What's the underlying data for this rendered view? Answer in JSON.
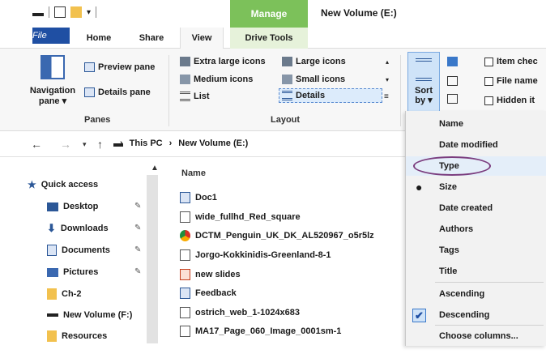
{
  "title_bar": {
    "manage_tab": "Manage",
    "window_title": "New Volume (E:)"
  },
  "ribbon_tabs": [
    "File",
    "Home",
    "Share",
    "View",
    "Drive Tools"
  ],
  "ribbon": {
    "panes": {
      "navigation_pane": "Navigation pane ▾",
      "preview_pane": "Preview pane",
      "details_pane": "Details pane",
      "group_label": "Panes"
    },
    "layout": {
      "extra_large_icons": "Extra large icons",
      "large_icons": "Large icons",
      "medium_icons": "Medium icons",
      "small_icons": "Small icons",
      "list": "List",
      "details": "Details",
      "group_label": "Layout"
    },
    "sort_by": "Sort by ▾",
    "show_hide": {
      "item_check_boxes": "Item chec",
      "file_name_extensions": "File name",
      "hidden_items": "Hidden it"
    }
  },
  "address_bar": {
    "crumbs": [
      "This PC",
      "New Volume (E:)"
    ]
  },
  "nav_pane": {
    "items": [
      {
        "label": "Quick access",
        "icon": "star-icon",
        "pinned": false
      },
      {
        "label": "Desktop",
        "icon": "desktop-folder-icon",
        "pinned": true
      },
      {
        "label": "Downloads",
        "icon": "download-arrow-icon",
        "pinned": true
      },
      {
        "label": "Documents",
        "icon": "documents-icon",
        "pinned": true
      },
      {
        "label": "Pictures",
        "icon": "pictures-icon",
        "pinned": true
      },
      {
        "label": "Ch-2",
        "icon": "folder-icon",
        "pinned": false
      },
      {
        "label": "New Volume (F:)",
        "icon": "drive-icon",
        "pinned": false
      },
      {
        "label": "Resources",
        "icon": "folder-icon",
        "pinned": false
      }
    ]
  },
  "file_list": {
    "column_header": "Name",
    "files": [
      {
        "name": "Doc1",
        "icon": "word-doc-icon"
      },
      {
        "name": "wide_fullhd_Red_square",
        "icon": "image-file-icon"
      },
      {
        "name": "DCTM_Penguin_UK_DK_AL520967_o5r5lz",
        "icon": "chrome-icon"
      },
      {
        "name": "Jorgo-Kokkinidis-Greenland-8-1",
        "icon": "image-file-icon"
      },
      {
        "name": "new slides",
        "icon": "powerpoint-icon"
      },
      {
        "name": "Feedback",
        "icon": "word-doc-icon"
      },
      {
        "name": "ostrich_web_1-1024x683",
        "icon": "image-file-icon"
      },
      {
        "name": "MA17_Page_060_Image_0001sm-1",
        "icon": "image-file-icon"
      }
    ]
  },
  "sort_menu": {
    "items": [
      "Name",
      "Date modified",
      "Type",
      "Size",
      "Date created",
      "Authors",
      "Tags",
      "Title",
      "Ascending",
      "Descending",
      "Choose columns..."
    ],
    "selected_column": "Size",
    "selected_order": "Descending",
    "circled": "Type"
  },
  "colors": {
    "file_tab": "#1f4fa3",
    "manage_tab": "#7cc15a",
    "circle_annotation": "#7b3d7e"
  }
}
